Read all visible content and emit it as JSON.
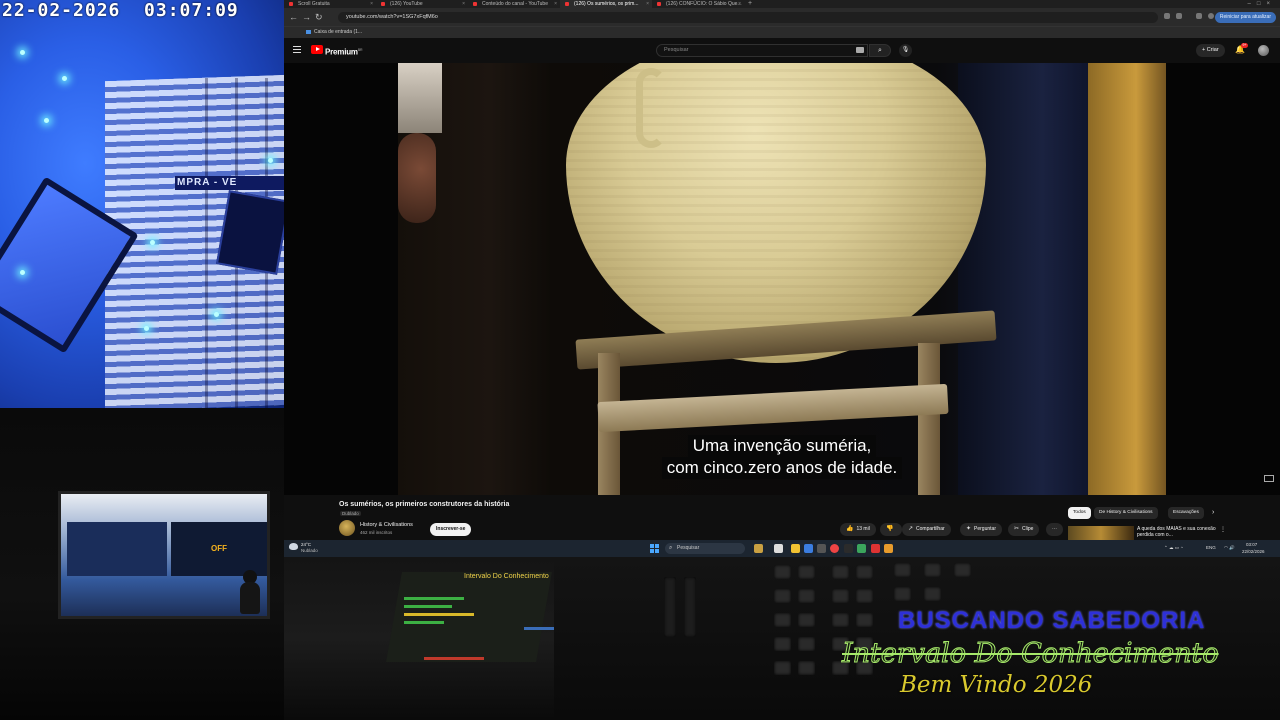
{
  "camera": {
    "timestamp": "22-02-2026  03:07:09",
    "sign_text": "MPRA - VE"
  },
  "browser": {
    "tabs": [
      {
        "label": "Scroll Gratuita"
      },
      {
        "label": "(126) YouTube"
      },
      {
        "label": "Conteúdo do canal - YouTube"
      },
      {
        "label": "(126) Os sumérios, os prim..."
      },
      {
        "label": "(126) CONFÚCIO: O Sábio Que..."
      }
    ],
    "url": "youtube.com/watch?v=1SG7xFqfM6o",
    "update_button": "Reiniciar para atualizar",
    "bookmark": "Caixa de entrada (1..."
  },
  "youtube": {
    "brand": "Premium",
    "search_placeholder": "Pesquisar",
    "create_label": "Criar",
    "notif_count": "9+",
    "subtitle_lines": [
      "Uma invenção suméria,",
      "com cinco.zero anos de idade."
    ],
    "video_title": "Os sumérios, os primeiros construtores da história",
    "dubbed_badge": "Dublado",
    "channel_name": "History & Civilisations",
    "channel_subs": "462 mil inscritos",
    "subscribe_label": "Inscrever-se",
    "actions": {
      "likes": "13 mil",
      "share": "Compartilhar",
      "ask": "Perguntar",
      "clip": "Clipe"
    },
    "chips": [
      "Todos",
      "De History & Civilisations",
      "Escavações"
    ],
    "recommended_title": "A queda dos MAIAS e sua conexão perdida com o..."
  },
  "taskbar": {
    "temperature": "24°C",
    "weather_desc": "Nublado",
    "search_placeholder": "Pesquisar",
    "lang": "ENG",
    "clock_time": "03:07",
    "clock_date": "22/02/2026"
  },
  "room": {
    "monitor_text": "OFF",
    "mixer_title": "Intervalo Do Conhecimento"
  },
  "overlay": {
    "line1": "BUSCANDO SABEDORIA",
    "line2": "Intervalo Do Conhecimento",
    "line3": "Bem Vindo 2026"
  }
}
